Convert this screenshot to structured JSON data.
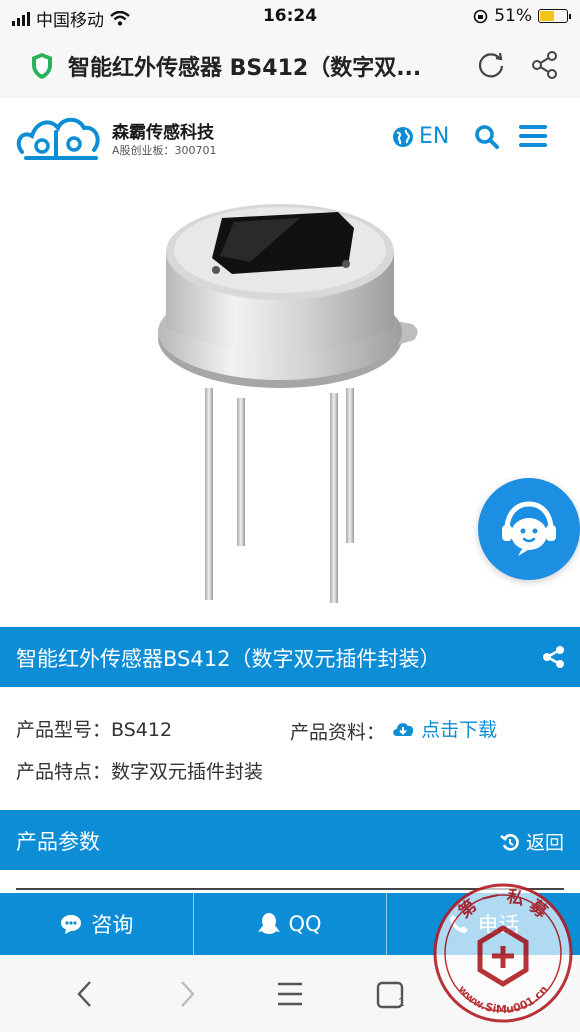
{
  "status_bar": {
    "carrier": "中国移动",
    "time": "16:24",
    "battery": "51%",
    "battery_level": 0.51
  },
  "browser": {
    "page_title": "智能红外传感器 BS412（数字双..."
  },
  "header": {
    "brand_name": "森霸传感科技",
    "brand_sub": "A股创业板：300701",
    "lang_label": "EN",
    "accent_color": "#0c8dd6"
  },
  "product": {
    "title": "智能红外传感器BS412（数字双元插件封装）",
    "model_label": "产品型号：",
    "model_value": "BS412",
    "docs_label": "产品资料：",
    "docs_link": "点击下载",
    "feature_label": "产品特点：",
    "feature_value": "数字双元插件封装"
  },
  "params": {
    "title": "产品参数",
    "back_label": "返回"
  },
  "bottom_actions": [
    {
      "label": "咨询",
      "icon": "chat-bubble-icon"
    },
    {
      "label": "QQ",
      "icon": "qq-penguin-icon"
    },
    {
      "label": "电话",
      "icon": "phone-icon"
    }
  ],
  "watermark": {
    "top_text": "第 一 私 募",
    "bottom_text": "www.SiMu001.cn"
  }
}
